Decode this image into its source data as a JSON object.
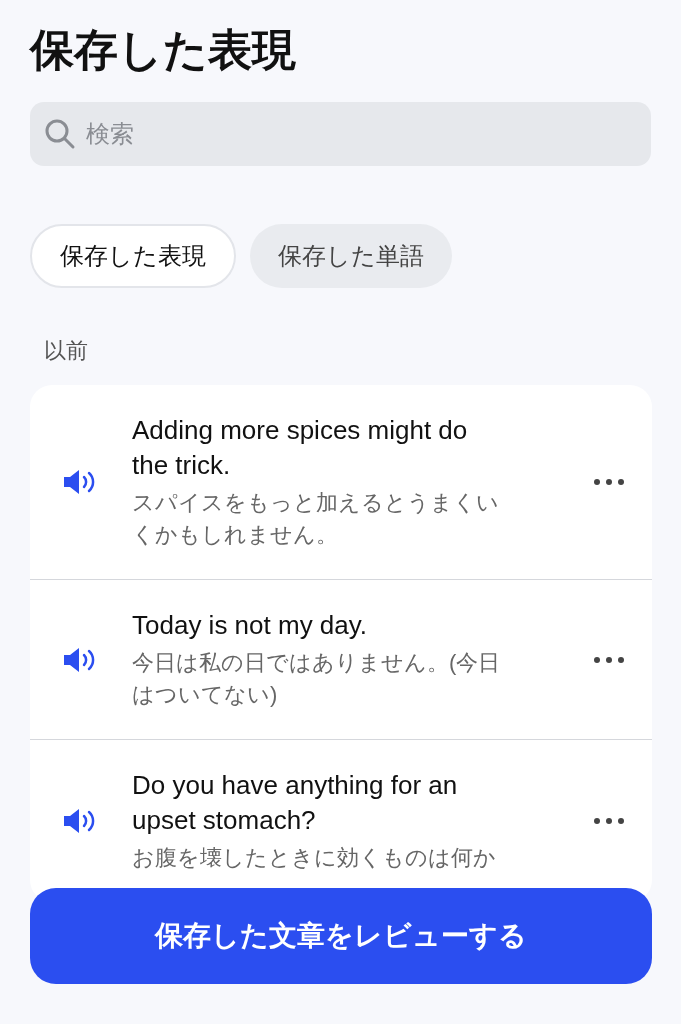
{
  "title": "保存した表現",
  "search": {
    "placeholder": "検索"
  },
  "tabs": [
    {
      "label": "保存した表現",
      "selected": true
    },
    {
      "label": "保存した単語",
      "selected": false
    }
  ],
  "section": "以前",
  "phrases": [
    {
      "text": "Adding more spices might do the trick.",
      "translation": "スパイスをもっと加えるとうまくいくかもしれません。"
    },
    {
      "text": "Today is not my day.",
      "translation": "今日は私の日ではありません。(今日はついてない)"
    },
    {
      "text": "Do you have anything for an upset stomach?",
      "translation": "お腹を壊したときに効くものは何か"
    }
  ],
  "review_button": "保存した文章をレビューする"
}
